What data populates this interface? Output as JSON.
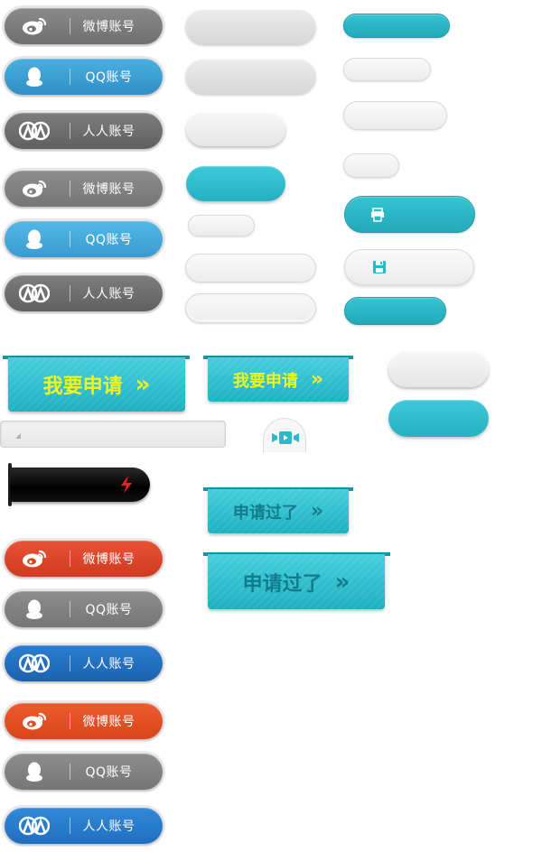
{
  "social_group1": [
    {
      "label": "微博账号",
      "icon": "weibo-icon",
      "variant": "gray"
    },
    {
      "label": "QQ账号",
      "icon": "qq-penguin-icon",
      "variant": "blue"
    },
    {
      "label": "人人账号",
      "icon": "renren-icon",
      "variant": "dark-gray"
    }
  ],
  "social_group2": [
    {
      "label": "微博账号",
      "icon": "weibo-icon",
      "variant": "gray"
    },
    {
      "label": "QQ账号",
      "icon": "qq-penguin-icon",
      "variant": "light-blue"
    },
    {
      "label": "人人账号",
      "icon": "renren-icon",
      "variant": "dark-gray"
    }
  ],
  "social_group3": [
    {
      "label": "微博账号",
      "icon": "weibo-icon",
      "variant": "red"
    },
    {
      "label": "QQ账号",
      "icon": "qq-penguin-icon",
      "variant": "gray"
    },
    {
      "label": "人人账号",
      "icon": "renren-icon",
      "variant": "dark-blue"
    }
  ],
  "social_group4": [
    {
      "label": "微博账号",
      "icon": "weibo-icon",
      "variant": "orange"
    },
    {
      "label": "QQ账号",
      "icon": "qq-penguin-icon",
      "variant": "gray"
    },
    {
      "label": "人人账号",
      "icon": "renren-icon",
      "variant": "blue"
    }
  ],
  "apply": {
    "label": "我要申请",
    "arrow": "»"
  },
  "applied": {
    "label": "申请过了",
    "arrow": "»"
  },
  "icons": {
    "print": "print-icon",
    "save": "save-icon",
    "video": "video-icon",
    "flash": "lightning-icon"
  },
  "colors": {
    "teal": "#2bb9c9",
    "yellow": "#f4f41c",
    "weibo_red": "#d8451b",
    "renren_blue": "#1b63b0",
    "qq_blue": "#2f8fc6"
  }
}
